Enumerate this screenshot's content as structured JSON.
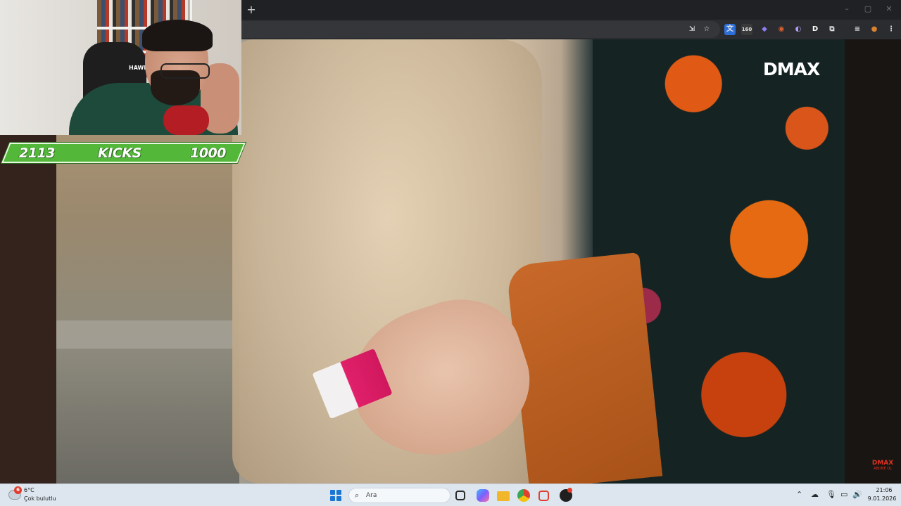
{
  "browser": {
    "new_tab_label": "+",
    "window_controls": [
      "–",
      "▢",
      "✕"
    ],
    "toolbar_icons": [
      {
        "name": "install-app-icon",
        "glyph": "⇲"
      },
      {
        "name": "bookmark-star-icon",
        "glyph": "☆"
      },
      {
        "name": "translate-extension-icon",
        "glyph": "文"
      },
      {
        "name": "counter-extension-icon",
        "glyph": "160"
      },
      {
        "name": "shield-extension-icon",
        "glyph": "◆"
      },
      {
        "name": "fox-extension-icon",
        "glyph": "◉"
      },
      {
        "name": "ai-extension-icon",
        "glyph": "◐"
      },
      {
        "name": "d-extension-icon",
        "glyph": "D"
      },
      {
        "name": "extensions-puzzle-icon",
        "glyph": "⧉"
      },
      {
        "name": "reading-list-icon",
        "glyph": "≡"
      },
      {
        "name": "profile-avatar-icon",
        "glyph": "●"
      },
      {
        "name": "menu-kebab-icon",
        "glyph": "⋮"
      }
    ]
  },
  "video": {
    "channel_logo": "DMAX",
    "mini_logo": "DMAX",
    "mini_logo_sub": "ABONE OL"
  },
  "webcam": {
    "chair_brand": "HAWK"
  },
  "kick_bar": {
    "left_value": "2113",
    "label": "KICKS",
    "right_value": "1000",
    "colors": {
      "fill": "#53b83a",
      "border": "#e9f7e0"
    }
  },
  "taskbar": {
    "weather_badge": "6",
    "weather_temp": "6°C",
    "weather_desc": "Çok bulutlu",
    "search_placeholder": "Ara",
    "apps": [
      {
        "name": "task-view-icon",
        "color": "#2b2b2b"
      },
      {
        "name": "copilot-icon",
        "color": "#7b61ff"
      },
      {
        "name": "file-explorer-icon",
        "color": "#f2b62b"
      },
      {
        "name": "chrome-icon",
        "color": "#e0412f"
      },
      {
        "name": "snipping-tool-icon",
        "color": "#e0412f"
      },
      {
        "name": "obs-icon",
        "color": "#1f1f1f"
      }
    ],
    "tray": {
      "chevron": "⌃",
      "clock_time": "21:06",
      "clock_date": "9.01.2026"
    }
  }
}
